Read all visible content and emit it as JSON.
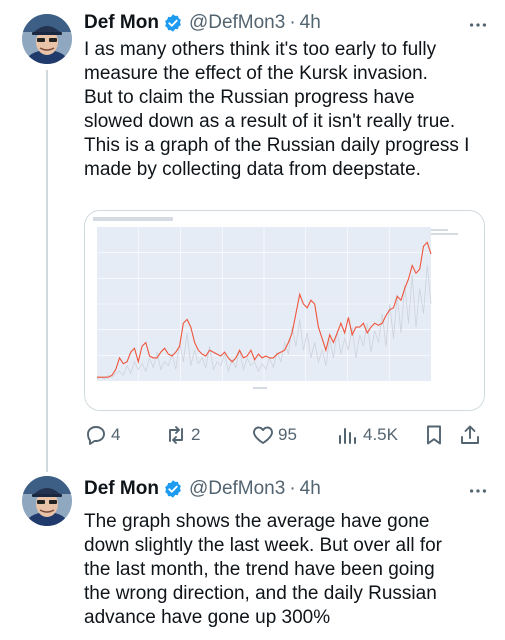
{
  "tweets": [
    {
      "author": "Def Mon",
      "handle": "@DefMon3",
      "time": "4h",
      "lines": [
        "I as many others think it's too early to fully",
        "measure the effect of the Kursk invasion.",
        "But to claim the Russian progress have",
        "slowed down as a result of it isn't really true.",
        "This is a graph of the Russian daily progress I",
        "made by collecting data from deepstate."
      ],
      "stats": {
        "replies": "4",
        "reposts": "2",
        "likes": "95",
        "views": "4.5K"
      }
    },
    {
      "author": "Def Mon",
      "handle": "@DefMon3",
      "time": "4h",
      "lines": [
        "The graph shows the average have gone",
        "down slightly the last week. But over all for",
        "the last month, the trend have been going",
        "the wrong direction, and the daily Russian",
        "advance have gone up 300%"
      ]
    }
  ],
  "colors": {
    "verified": "#1d9bf0",
    "muted": "#536471",
    "chart_bg": "#e5ecf6",
    "line_red": "#ef553b",
    "line_gray": "#cdd3dc"
  },
  "icons": [
    "verified-badge-icon",
    "more-icon",
    "reply-icon",
    "repost-icon",
    "like-icon",
    "views-icon",
    "bookmark-icon",
    "share-icon"
  ],
  "chart_data": {
    "type": "line",
    "series": [
      {
        "values": [
          2,
          2,
          2,
          2,
          3,
          6,
          12,
          9,
          10,
          15,
          17,
          10,
          18,
          20,
          13,
          12,
          12,
          15,
          17,
          14,
          13,
          15,
          18,
          30,
          32,
          28,
          20,
          16,
          14,
          13,
          16,
          15,
          14,
          13,
          15,
          12,
          10,
          12,
          16,
          12,
          13,
          16,
          11,
          14,
          12,
          13,
          12,
          12,
          14,
          15,
          16,
          20,
          25,
          35,
          45,
          40,
          38,
          42,
          40,
          28,
          22,
          16,
          24,
          20,
          25,
          30,
          25,
          33,
          24,
          28,
          28,
          30,
          25,
          28,
          30,
          29,
          30,
          34,
          37,
          38,
          44,
          42,
          48,
          53,
          60,
          56,
          58,
          70,
          72,
          66
        ]
      },
      {
        "values": [
          1,
          2,
          1,
          3,
          2,
          4,
          5,
          3,
          8,
          4,
          10,
          6,
          9,
          5,
          12,
          7,
          15,
          6,
          10,
          8,
          14,
          6,
          20,
          10,
          25,
          8,
          16,
          9,
          12,
          7,
          18,
          6,
          10,
          8,
          14,
          5,
          11,
          7,
          16,
          6,
          12,
          8,
          10,
          5,
          9,
          6,
          12,
          7,
          15,
          10,
          20,
          14,
          28,
          18,
          32,
          16,
          25,
          12,
          20,
          10,
          16,
          8,
          22,
          12,
          26,
          14,
          22,
          16,
          28,
          12,
          24,
          18,
          30,
          15,
          26,
          20,
          35,
          18,
          40,
          22,
          45,
          25,
          50,
          30,
          55,
          28,
          48,
          35,
          60,
          40
        ]
      }
    ]
  }
}
